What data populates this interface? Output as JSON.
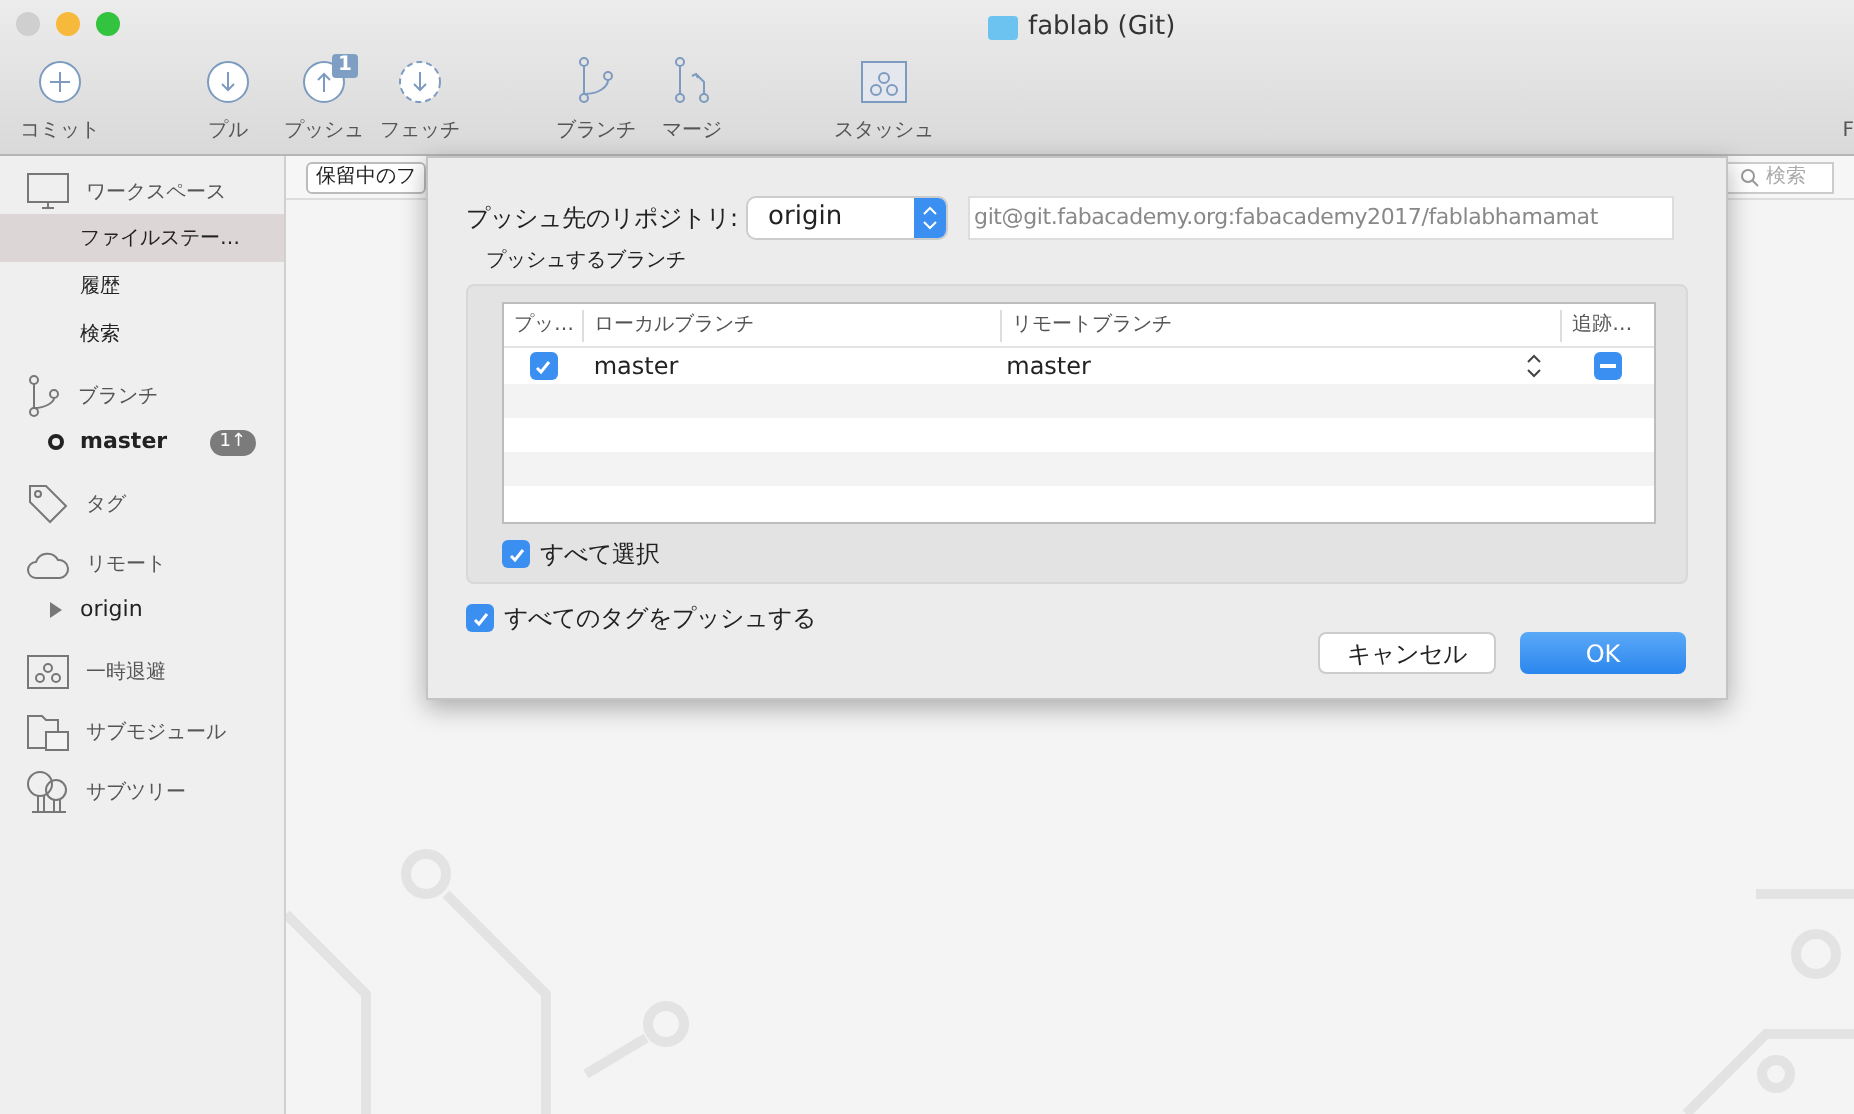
{
  "window": {
    "title": "fablab (Git)"
  },
  "toolbar": {
    "groups": [
      [
        {
          "kind": "commit",
          "label": "コミット"
        }
      ],
      [
        {
          "kind": "pull",
          "label": "プル"
        },
        {
          "kind": "push",
          "label": "プッシュ",
          "badge": "1"
        },
        {
          "kind": "fetch",
          "label": "フェッチ"
        }
      ],
      [
        {
          "kind": "branch",
          "label": "ブランチ"
        },
        {
          "kind": "merge",
          "label": "マージ"
        }
      ],
      [
        {
          "kind": "stash",
          "label": "スタッシュ"
        }
      ]
    ],
    "cut_label": "F"
  },
  "sidebar": {
    "sections": [
      {
        "kind": "workspace",
        "label": "ワークスペース",
        "children": [
          {
            "label": "ファイルステー…",
            "selected": true
          },
          {
            "label": "履歴",
            "selected": false
          },
          {
            "label": "検索",
            "selected": false
          }
        ]
      },
      {
        "kind": "branches",
        "label": "ブランチ",
        "children": [
          {
            "label": "master",
            "selected": false,
            "current": true,
            "badge": "1↑"
          }
        ]
      },
      {
        "kind": "tags",
        "label": "タグ"
      },
      {
        "kind": "remotes",
        "label": "リモート",
        "children": [
          {
            "label": "origin",
            "selected": false,
            "expanded": false
          }
        ]
      },
      {
        "kind": "stashes",
        "label": "一時退避"
      },
      {
        "kind": "submodules",
        "label": "サブモジュール"
      },
      {
        "kind": "subtrees",
        "label": "サブツリー"
      }
    ]
  },
  "main": {
    "filter_button": "保留中のフ",
    "search": {
      "placeholder": "検索"
    }
  },
  "dialog": {
    "repo_label": "プッシュ先のリポジトリ:",
    "repo_select": "origin",
    "repo_url": "git@git.fabacademy.org:fabacademy2017/fablabhamamat",
    "group_title": "プッシュするブランチ",
    "columns": [
      "プッ…",
      "ローカルブランチ",
      "リモートブランチ",
      "追跡…"
    ],
    "rows": [
      {
        "push": true,
        "local": "master",
        "remote": "master",
        "tracking_mixed": true
      }
    ],
    "select_all": {
      "label": "すべて選択",
      "checked": true
    },
    "push_tags": {
      "label": "すべてのタグをプッシュする",
      "checked": true
    },
    "buttons": [
      {
        "kind": "default",
        "label": "キャンセル"
      },
      {
        "kind": "primary",
        "label": "OK"
      }
    ]
  }
}
